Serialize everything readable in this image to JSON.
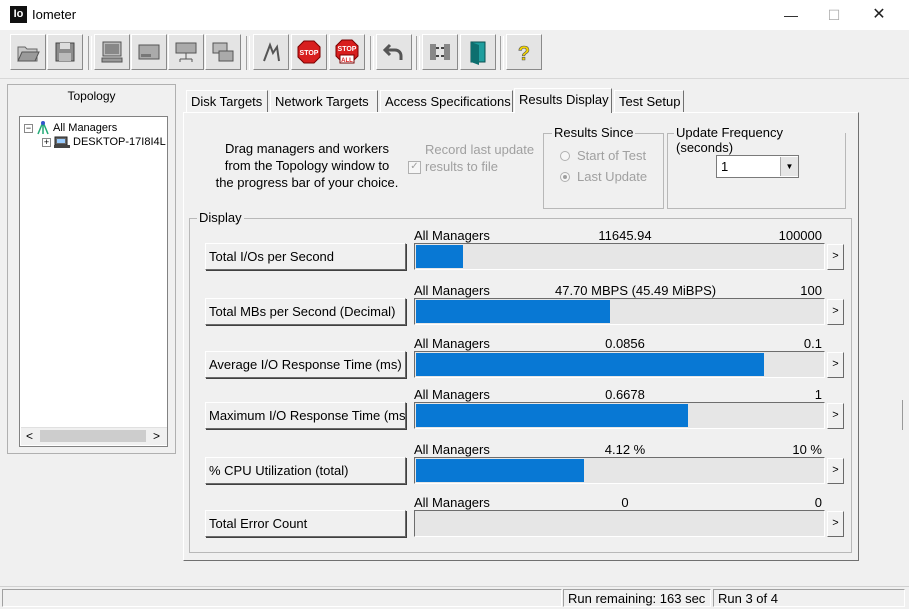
{
  "window": {
    "title": "Iometer",
    "icon_text": "Io",
    "minimize": "—",
    "maximize": "☐",
    "close": "✕"
  },
  "toolbar": {
    "buttons": [
      {
        "name": "open-config-icon"
      },
      {
        "name": "save-config-icon"
      },
      {
        "name": "start-disk-manager-icon"
      },
      {
        "name": "new-disk-worker-icon"
      },
      {
        "name": "new-network-worker-icon"
      },
      {
        "name": "copy-worker-icon"
      },
      {
        "name": "start-tests-icon"
      },
      {
        "name": "stop-icon",
        "text": "STOP"
      },
      {
        "name": "stop-all-icon",
        "text": "STOP",
        "sub": "ALL"
      },
      {
        "name": "reset-workers-icon"
      },
      {
        "name": "disconnect-icon"
      },
      {
        "name": "exit-icon"
      },
      {
        "name": "help-icon",
        "text": "?"
      }
    ]
  },
  "topology": {
    "title": "Topology",
    "root": {
      "label": "All Managers",
      "expander": "−"
    },
    "child": {
      "label": "DESKTOP-17I8I4L",
      "expander": "+"
    },
    "scroll_left": "<",
    "scroll_right": ">"
  },
  "tabs": [
    {
      "label": "Disk Targets"
    },
    {
      "label": "Network Targets"
    },
    {
      "label": "Access Specifications"
    },
    {
      "label": "Results Display",
      "active": true
    },
    {
      "label": "Test Setup"
    }
  ],
  "results": {
    "drag_text": "Drag managers and workers from the Topology window to the progress bar of your choice.",
    "record_label": "Record last update results to file",
    "record_checked": "✓",
    "results_since": {
      "title": "Results Since",
      "options": [
        "Start of Test",
        "Last Update"
      ],
      "selected": "Last Update"
    },
    "update_frequency": {
      "title": "Update Frequency (seconds)",
      "value": "1",
      "arrow": "▼"
    },
    "display_title": "Display",
    "more_label": ">",
    "metrics": [
      {
        "button": "Total I/Os per Second",
        "target": "All Managers",
        "value": "11645.94",
        "max": "100000",
        "fraction": 0.1165
      },
      {
        "button": "Total MBs per Second (Decimal)",
        "target": "All Managers",
        "value": "47.70 MBPS (45.49 MiBPS)",
        "max": "100",
        "fraction": 0.477
      },
      {
        "button": "Average I/O Response Time (ms)",
        "target": "All Managers",
        "value": "0.0856",
        "max": "0.1",
        "fraction": 0.856
      },
      {
        "button": "Maximum I/O Response Time (ms)",
        "target": "All Managers",
        "value": "0.6678",
        "max": "1",
        "fraction": 0.6678
      },
      {
        "button": "% CPU Utilization (total)",
        "target": "All Managers",
        "value": "4.12 %",
        "max": "10 %",
        "fraction": 0.412
      },
      {
        "button": "Total Error Count",
        "target": "All Managers",
        "value": "0",
        "max": "0",
        "fraction": 0
      }
    ]
  },
  "status": {
    "remaining": "Run remaining: 163 sec",
    "run": "Run 3 of 4"
  },
  "colors": {
    "bar": "#0878d4",
    "stop_red": "#d81e1e"
  }
}
